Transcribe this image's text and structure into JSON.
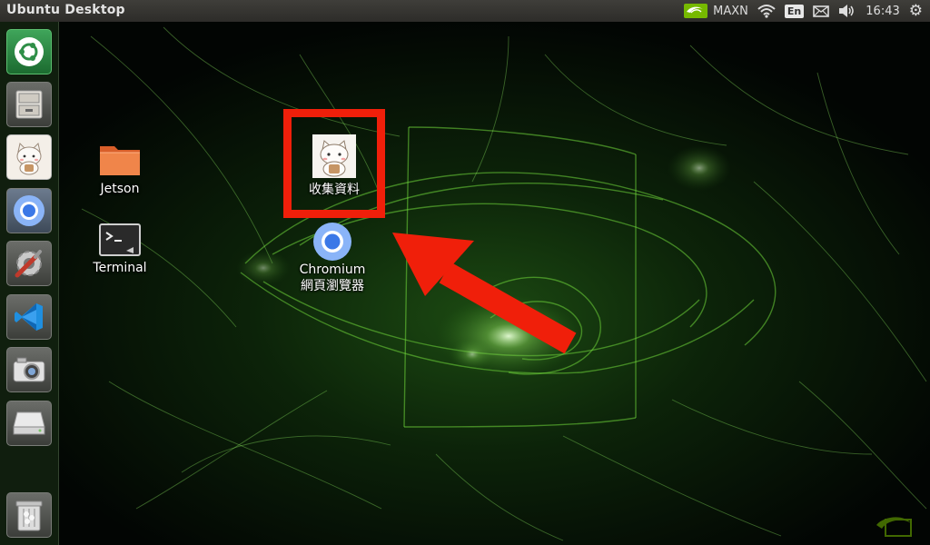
{
  "top_panel": {
    "app_title": "Ubuntu Desktop",
    "power_mode": "MAXN",
    "keyboard_layout": "En",
    "clock": "16:43",
    "icons": [
      "nvidia-icon",
      "wifi-icon",
      "keyboard-icon",
      "mail-icon",
      "volume-icon",
      "gear-icon"
    ]
  },
  "launcher": {
    "items": [
      {
        "name": "ubuntu-software-icon"
      },
      {
        "name": "file-cabinet-icon"
      },
      {
        "name": "cat-app-icon"
      },
      {
        "name": "chromium-icon"
      },
      {
        "name": "system-settings-icon"
      },
      {
        "name": "vscode-icon"
      },
      {
        "name": "camera-icon"
      },
      {
        "name": "drive-icon"
      },
      {
        "name": "trash-icon"
      }
    ]
  },
  "desktop": {
    "icons": [
      {
        "label": "Jetson",
        "icon": "folder-icon"
      },
      {
        "label": "Terminal",
        "icon": "terminal-icon"
      },
      {
        "label": "收集資料",
        "icon": "cat-app-icon"
      },
      {
        "label_line1": "Chromium",
        "label_line2": "網頁瀏覽器",
        "icon": "chromium-icon"
      }
    ]
  },
  "annotation": {
    "highlight_color": "#f01f0a",
    "arrow_color": "#f01f0a"
  },
  "colors": {
    "nvidia_green": "#76b900",
    "accent_red": "#f01f0a"
  }
}
